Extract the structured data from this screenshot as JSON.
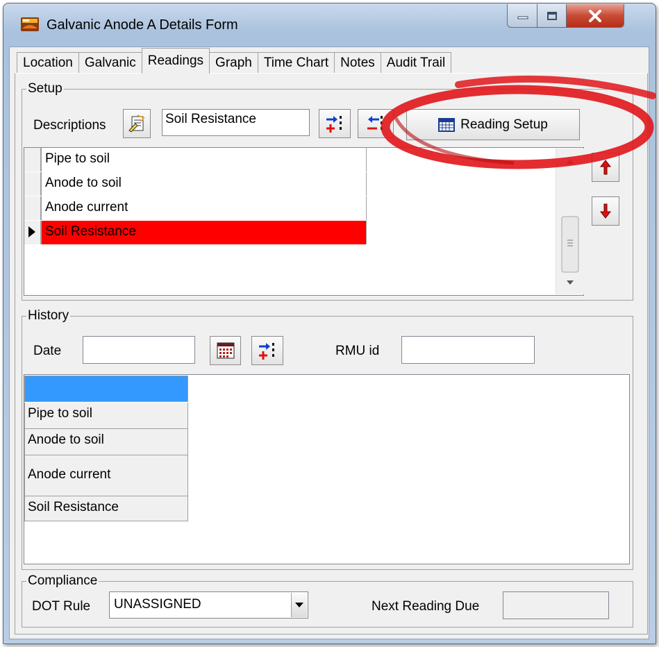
{
  "window": {
    "title": "Galvanic Anode A Details Form"
  },
  "tabs": [
    {
      "label": "Location"
    },
    {
      "label": "Galvanic"
    },
    {
      "label": "Readings"
    },
    {
      "label": "Graph"
    },
    {
      "label": "Time Chart"
    },
    {
      "label": "Notes"
    },
    {
      "label": "Audit Trail"
    }
  ],
  "active_tab": "Readings",
  "setup": {
    "legend": "Setup",
    "descriptions_label": "Descriptions",
    "description_value": "Soil Resistance",
    "reading_setup_label": "Reading Setup",
    "rows": [
      {
        "label": "Pipe to soil",
        "selected": false
      },
      {
        "label": "Anode to soil",
        "selected": false
      },
      {
        "label": "Anode current",
        "selected": false
      },
      {
        "label": "Soil Resistance",
        "selected": true
      }
    ],
    "selected_color": "#ff0000"
  },
  "history": {
    "legend": "History",
    "date_label": "Date",
    "date_value": "",
    "rmu_label": "RMU id",
    "rmu_value": "",
    "header_color": "#3399ff",
    "rows": [
      {
        "label": "Pipe to soil"
      },
      {
        "label": "Anode to soil"
      },
      {
        "label": "Anode current"
      },
      {
        "label": "Soil Resistance"
      }
    ]
  },
  "compliance": {
    "legend": "Compliance",
    "dot_rule_label": "DOT Rule",
    "dot_rule_value": "UNASSIGNED",
    "next_reading_label": "Next Reading Due",
    "next_reading_value": ""
  },
  "annotation_color": "#e0161b"
}
